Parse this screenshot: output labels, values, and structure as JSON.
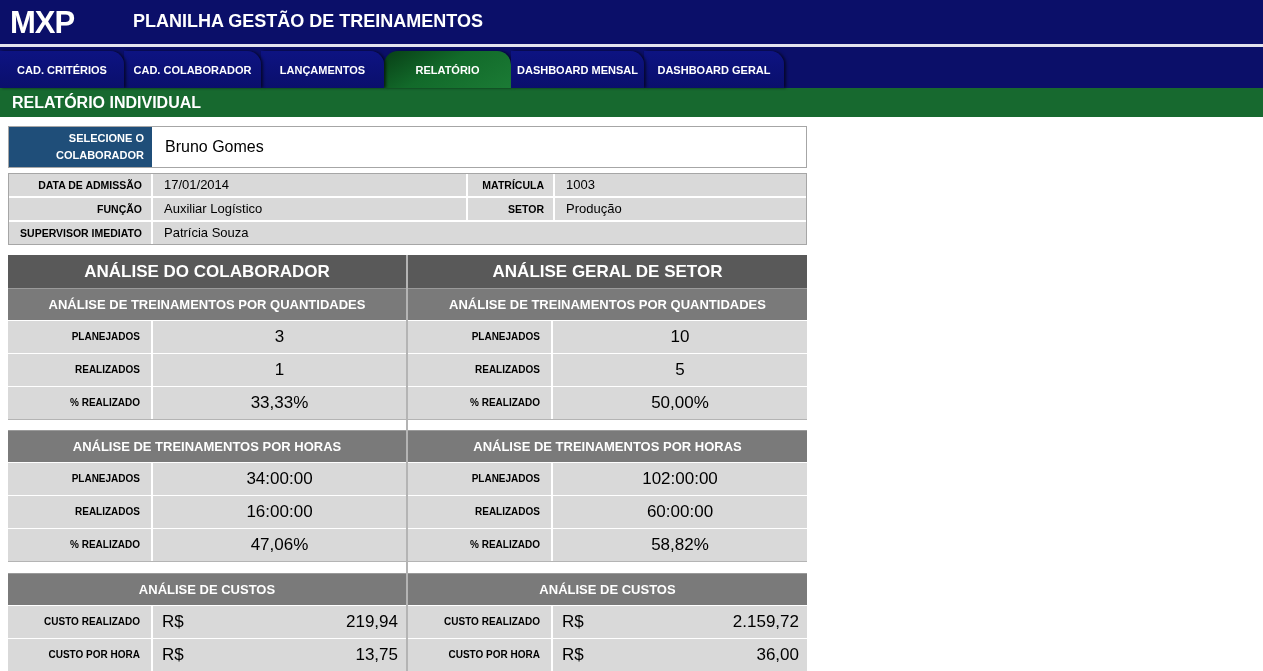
{
  "header": {
    "logo": "MXP",
    "title": "PLANILHA GESTÃO DE TREINAMENTOS"
  },
  "tabs": [
    {
      "label": "CAD. CRITÉRIOS",
      "selected": false
    },
    {
      "label": "CAD. COLABORADOR",
      "selected": false
    },
    {
      "label": "LANÇAMENTOS",
      "selected": false
    },
    {
      "label": "RELATÓRIO",
      "selected": true
    },
    {
      "label": "DASHBOARD MENSAL",
      "selected": false
    },
    {
      "label": "DASHBOARD GERAL",
      "selected": false
    }
  ],
  "section_title": "RELATÓRIO INDIVIDUAL",
  "selector": {
    "label": "SELECIONE O COLABORADOR",
    "value": "Bruno Gomes"
  },
  "details": [
    [
      {
        "label": "DATA DE ADMISSÃO",
        "value": "17/01/2014"
      },
      {
        "label": "MATRÍCULA",
        "value": "1003"
      }
    ],
    [
      {
        "label": "FUNÇÃO",
        "value": "Auxiliar Logístico"
      },
      {
        "label": "SETOR",
        "value": "Produção"
      }
    ],
    [
      {
        "label": "SUPERVISOR IMEDIATO",
        "value": "Patrícia Souza"
      }
    ]
  ],
  "panels": [
    {
      "title": "ANÁLISE DO COLABORADOR",
      "groups": [
        {
          "title": "ANÁLISE DE TREINAMENTOS POR QUANTIDADES",
          "rows": [
            {
              "label": "PLANEJADOS",
              "value": "3"
            },
            {
              "label": "REALIZADOS",
              "value": "1"
            },
            {
              "label": "% REALIZADO",
              "value": "33,33%"
            }
          ]
        },
        {
          "title": "ANÁLISE DE TREINAMENTOS POR HORAS",
          "rows": [
            {
              "label": "PLANEJADOS",
              "value": "34:00:00"
            },
            {
              "label": "REALIZADOS",
              "value": "16:00:00"
            },
            {
              "label": "% REALIZADO",
              "value": "47,06%"
            }
          ]
        },
        {
          "title": "ANÁLISE DE CUSTOS",
          "rows": [
            {
              "label": "CUSTO REALIZADO",
              "currency": "R$",
              "value": "219,94"
            },
            {
              "label": "CUSTO POR HORA",
              "currency": "R$",
              "value": "13,75"
            }
          ]
        }
      ]
    },
    {
      "title": "ANÁLISE GERAL DE SETOR",
      "groups": [
        {
          "title": "ANÁLISE DE TREINAMENTOS POR QUANTIDADES",
          "rows": [
            {
              "label": "PLANEJADOS",
              "value": "10"
            },
            {
              "label": "REALIZADOS",
              "value": "5"
            },
            {
              "label": "% REALIZADO",
              "value": "50,00%"
            }
          ]
        },
        {
          "title": "ANÁLISE DE TREINAMENTOS POR HORAS",
          "rows": [
            {
              "label": "PLANEJADOS",
              "value": "102:00:00"
            },
            {
              "label": "REALIZADOS",
              "value": "60:00:00"
            },
            {
              "label": "% REALIZADO",
              "value": "58,82%"
            }
          ]
        },
        {
          "title": "ANÁLISE DE CUSTOS",
          "rows": [
            {
              "label": "CUSTO REALIZADO",
              "currency": "R$",
              "value": "2.159,72"
            },
            {
              "label": "CUSTO POR HORA",
              "currency": "R$",
              "value": "36,00"
            }
          ]
        }
      ]
    }
  ]
}
